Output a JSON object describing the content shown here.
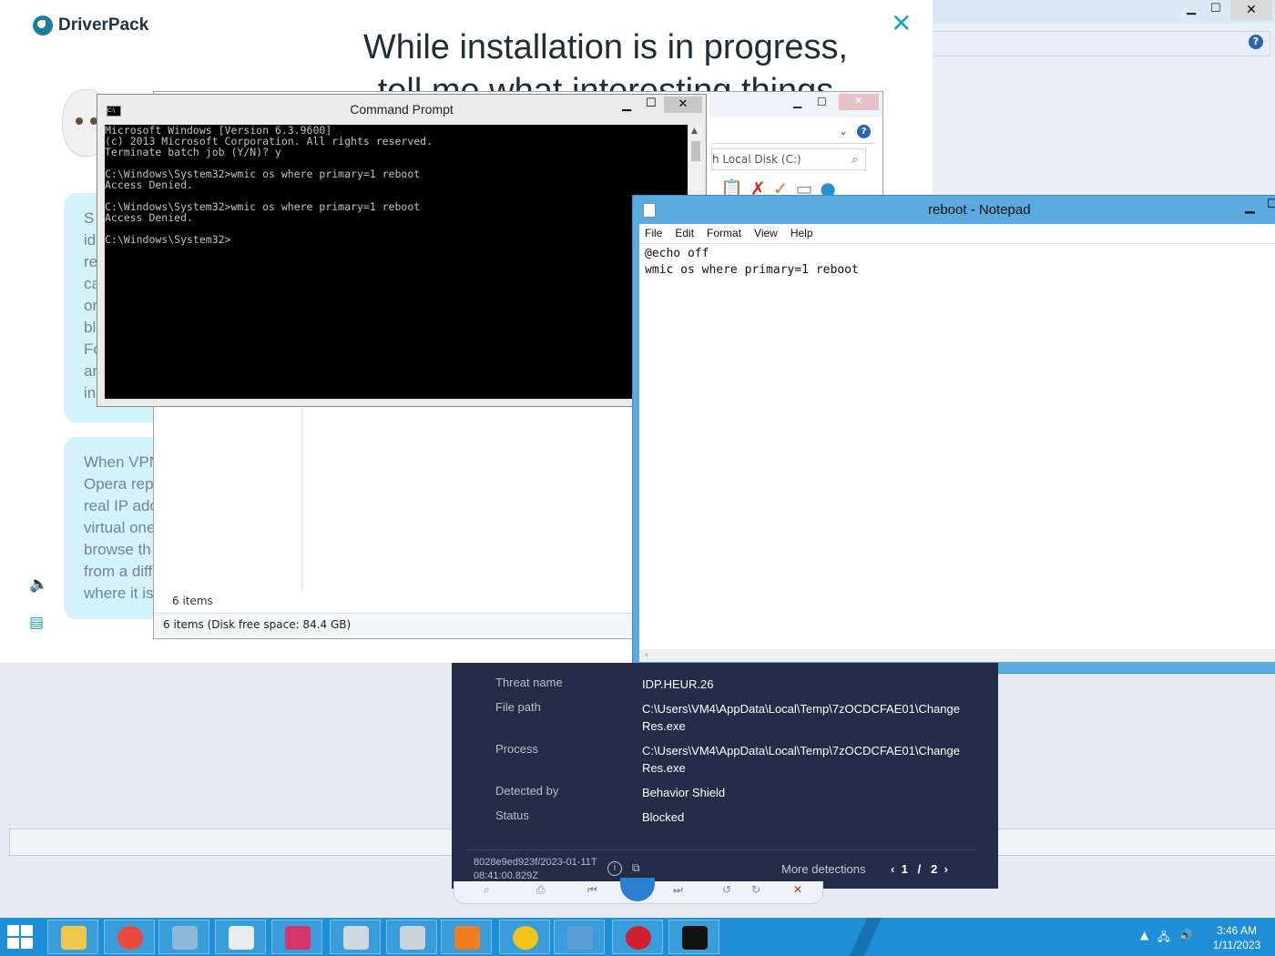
{
  "driverpack": {
    "brand": "DriverPack",
    "heading_line1": "While installation is in progress,",
    "heading_line2": "tell me what interesting things",
    "bubble1_letters": "S\nid\nre\nca\nor\nbl\nFo\nar\nin",
    "bubble2_lines": "When VPN\nOpera rep\nreal IP add\nvirtual one\nbrowse th\nfrom a diff\nwhere it is"
  },
  "cmd": {
    "title": "Command Prompt",
    "output": "Microsoft Windows [Version 6.3.9600]\n(c) 2013 Microsoft Corporation. All rights reserved.\nTerminate batch job (Y/N)? y\n\nC:\\Windows\\System32>wmic os where primary=1 reboot\nAccess Denied.\n\nC:\\Windows\\System32>wmic os where primary=1 reboot\nAccess Denied.\n\nC:\\Windows\\System32>"
  },
  "explorer": {
    "search_placeholder": "h Local Disk (C:)",
    "items_label": "6 items",
    "status_text": "6 items (Disk free space: 84.4 GB)"
  },
  "notepad": {
    "title": "reboot - Notepad",
    "menu": [
      "File",
      "Edit",
      "Format",
      "View",
      "Help"
    ],
    "content": "@echo off\nwmic os where primary=1 reboot"
  },
  "threat": {
    "rows": [
      {
        "key": "Threat name",
        "value": "IDP.HEUR.26"
      },
      {
        "key": "File path",
        "value": "C:\\Users\\VM4\\AppData\\Local\\Temp\\7zOCDCFAE01\\ChangeRes.exe"
      },
      {
        "key": "Process",
        "value": "C:\\Users\\VM4\\AppData\\Local\\Temp\\7zOCDCFAE01\\ChangeRes.exe"
      },
      {
        "key": "Detected by",
        "value": "Behavior Shield"
      },
      {
        "key": "Status",
        "value": "Blocked"
      }
    ],
    "detection_id": "8028e9ed923f/2023-01-11T08:41:00.829Z",
    "more_detections": "More detections",
    "page_current": "1",
    "page_sep": "/",
    "page_total": "2"
  },
  "taskbar": {
    "time": "3:46 AM",
    "date": "1/11/2023",
    "apps": [
      {
        "name": "file-explorer",
        "color": "#f2c84b"
      },
      {
        "name": "chrome",
        "color": "#e84b3c"
      },
      {
        "name": "notepad-pen",
        "color": "#8fb7d6"
      },
      {
        "name": "task-window",
        "color": "#e8ecef"
      },
      {
        "name": "ds-app",
        "color": "#d5356f"
      },
      {
        "name": "system-monitor",
        "color": "#cfd8e0"
      },
      {
        "name": "network-tool",
        "color": "#c9d2db"
      },
      {
        "name": "avast",
        "color": "#f07e21"
      },
      {
        "name": "vpn-shield",
        "color": "#f5c41c"
      },
      {
        "name": "photos",
        "color": "#5e9ed6"
      },
      {
        "name": "opera",
        "color": "#d0202f"
      },
      {
        "name": "cmd-taskbar",
        "color": "#111111"
      }
    ]
  }
}
